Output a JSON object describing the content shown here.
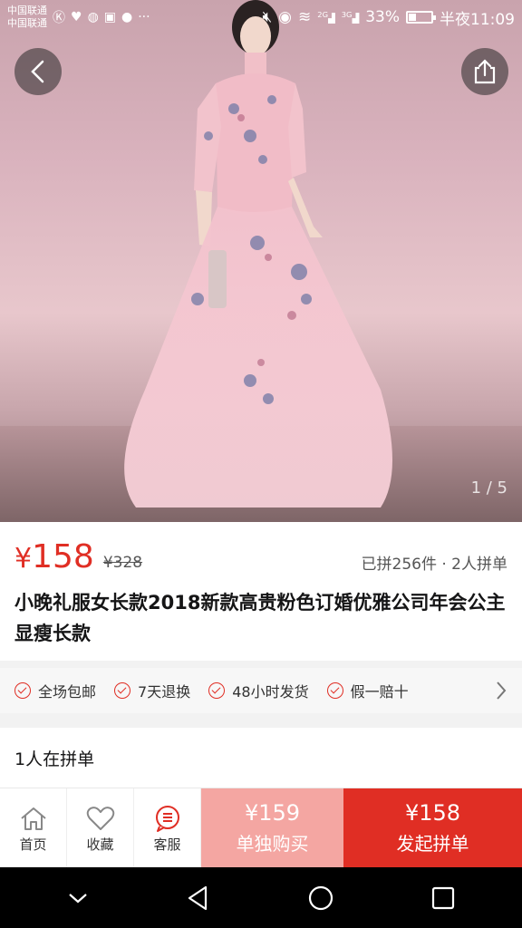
{
  "status_bar": {
    "carrier1": "中国联通",
    "carrier2": "中国联通",
    "signal1": "2G",
    "signal2": "3G",
    "battery": "33%",
    "time": "半夜11:09"
  },
  "gallery": {
    "pager": "1 / 5"
  },
  "product": {
    "price_symbol": "¥",
    "price": "158",
    "original_price": "¥328",
    "sold_info": "已拼256件 · 2人拼单",
    "title": "小晚礼服女长款2018新款高贵粉色订婚优雅公司年会公主显瘦长款"
  },
  "services": [
    "全场包邮",
    "7天退换",
    "48小时发货",
    "假一赔十"
  ],
  "group_section": {
    "label": "1人在拼单"
  },
  "action_bar": {
    "home": "首页",
    "favorite": "收藏",
    "service": "客服",
    "single_price": "¥159",
    "single_label": "单独购买",
    "group_price": "¥158",
    "group_label": "发起拼单"
  },
  "colors": {
    "accent": "#e02e24",
    "single_bg": "#f4a6a2"
  }
}
